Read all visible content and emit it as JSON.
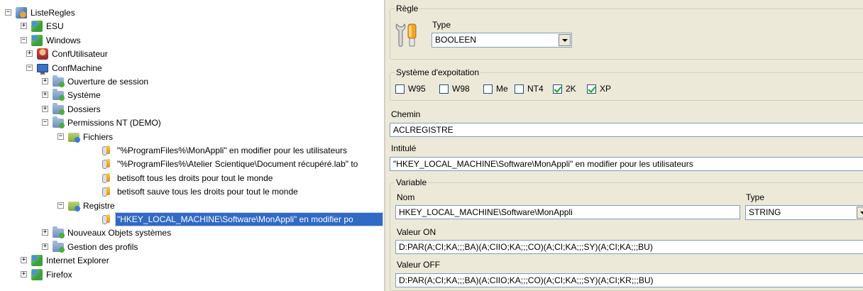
{
  "tree": {
    "nodes": [
      {
        "label": "ListeRegles",
        "exp": "−",
        "icon": "root-icon",
        "level": 0
      },
      {
        "label": "ESU",
        "exp": "+",
        "icon": "os-icon",
        "level": 1
      },
      {
        "label": "Windows",
        "exp": "−",
        "icon": "os-icon",
        "level": 1
      },
      {
        "label": "ConfUtilisateur",
        "exp": "+",
        "icon": "user-config-icon",
        "level": 2
      },
      {
        "label": "ConfMachine",
        "exp": "−",
        "icon": "computer-icon",
        "level": 2
      },
      {
        "label": "Ouverture de session",
        "exp": "+",
        "icon": "folder-icon",
        "level": 3
      },
      {
        "label": "Système",
        "exp": "+",
        "icon": "folder-icon",
        "level": 3
      },
      {
        "label": "Dossiers",
        "exp": "+",
        "icon": "folder-icon",
        "level": 3
      },
      {
        "label": "Permissions NT (DEMO)",
        "exp": "−",
        "icon": "folder-icon",
        "level": 3
      },
      {
        "label": "Fichiers",
        "exp": "−",
        "icon": "open-folder-icon",
        "level": 4
      },
      {
        "label": "\"%ProgramFiles%\\MonAppli\" en modifier pour les utilisateurs",
        "exp": "",
        "icon": "rule-icon",
        "level": 5
      },
      {
        "label": "\"%ProgramFiles%\\Atelier Scientique\\Document récupéré.lab\" to",
        "exp": "",
        "icon": "rule-icon",
        "level": 5
      },
      {
        "label": "betisoft tous les droits pour tout le monde",
        "exp": "",
        "icon": "rule-icon",
        "level": 5
      },
      {
        "label": "betisoft sauve tous les droits pour tout le monde",
        "exp": "",
        "icon": "rule-icon",
        "level": 5
      },
      {
        "label": "Registre",
        "exp": "−",
        "icon": "open-folder-icon",
        "level": 4
      },
      {
        "label": "\"HKEY_LOCAL_MACHINE\\Software\\MonAppli\" en modifier po",
        "exp": "",
        "icon": "rule-icon",
        "level": 5,
        "selected": true
      },
      {
        "label": "Nouveaux Objets systèmes",
        "exp": "+",
        "icon": "folder-icon",
        "level": 3
      },
      {
        "label": "Gestion des profils",
        "exp": "+",
        "icon": "folder-icon",
        "level": 3
      },
      {
        "label": "Internet Explorer",
        "exp": "+",
        "icon": "os-icon",
        "level": 1
      },
      {
        "label": "Firefox",
        "exp": "+",
        "icon": "os-icon",
        "level": 1
      }
    ]
  },
  "form": {
    "regle": {
      "legend": "Règle",
      "type_label": "Type",
      "type_value": "BOOLEEN",
      "icon": "wrench-rule-icon"
    },
    "os": {
      "legend": "Système d'expoitation",
      "options": [
        {
          "label": "W95",
          "checked": false
        },
        {
          "label": "W98",
          "checked": false
        },
        {
          "label": "Me",
          "checked": false
        },
        {
          "label": "NT4",
          "checked": false
        },
        {
          "label": "2K",
          "checked": true
        },
        {
          "label": "XP",
          "checked": true
        }
      ]
    },
    "chemin": {
      "label": "Chemin",
      "value": "ACLREGISTRE"
    },
    "intitule": {
      "label": "Intitulé",
      "value": "\"HKEY_LOCAL_MACHINE\\Software\\MonAppli\" en modifier pour les utilisateurs"
    },
    "variable": {
      "legend": "Variable",
      "nom_label": "Nom",
      "nom_value": "HKEY_LOCAL_MACHINE\\Software\\MonAppli",
      "type_label": "Type",
      "type_value": "STRING",
      "valeur_on_label": "Valeur ON",
      "valeur_on": "D:PAR(A;CI;KA;;;BA)(A;CIIO;KA;;;CO)(A;CI;KA;;;SY)(A;CI;KA;;;BU)",
      "valeur_off_label": "Valeur OFF",
      "valeur_off": "D:PAR(A;CI;KA;;;BA)(A;CIIO;KA;;;CO)(A;CI;KA;;;SY)(A;CI;KR;;;BU)"
    }
  },
  "colors": {
    "selection": "#316ac5",
    "panel": "#ece9d8",
    "input_border": "#7f9db9"
  }
}
